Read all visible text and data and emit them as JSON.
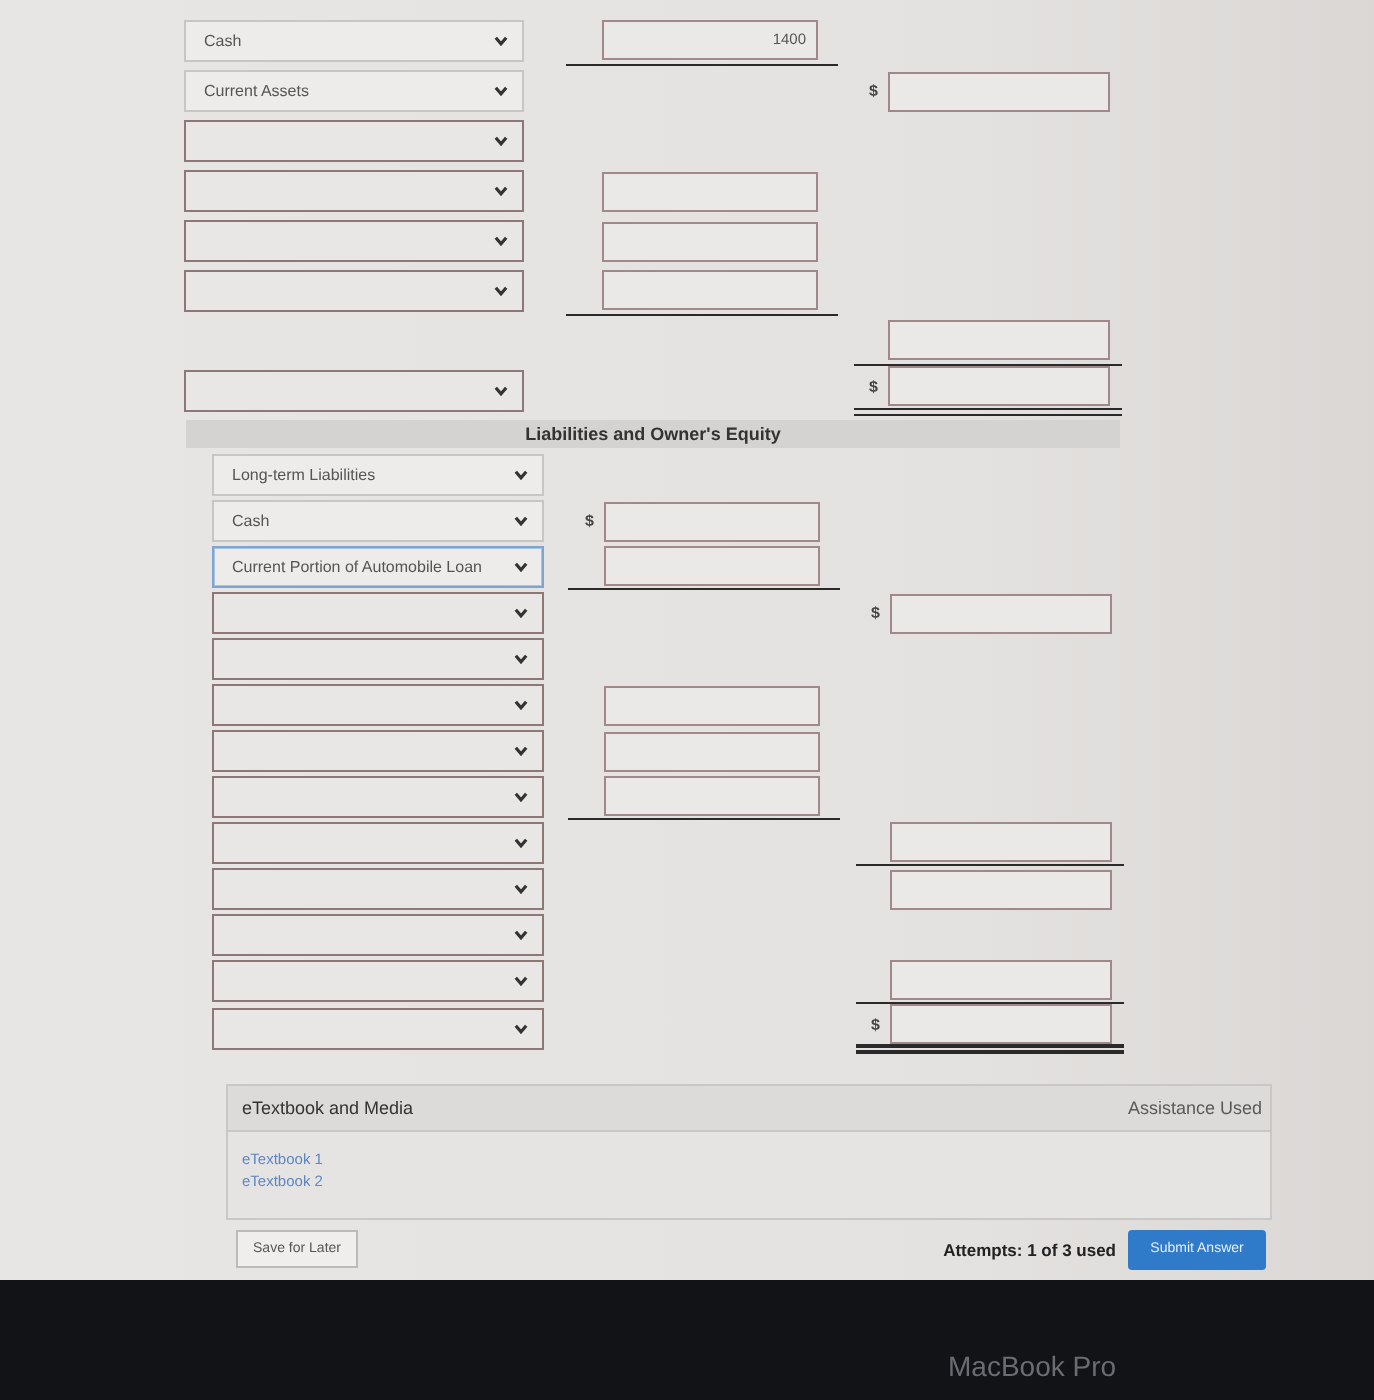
{
  "assets": {
    "rows": [
      {
        "account": {
          "value": "Cash",
          "focused": false
        },
        "amount": {
          "value": "1400",
          "underlined": true,
          "double_underlined": false
        }
      },
      {
        "account": {
          "value": "Current Assets",
          "focused": false
        },
        "total": {
          "currency": "$",
          "underlined": false,
          "double_underlined": false
        }
      },
      {
        "account": {
          "focused": false
        }
      },
      {
        "account": {
          "focused": false
        },
        "amount": {
          "underlined": false,
          "double_underlined": false
        }
      },
      {
        "account": {
          "focused": false
        },
        "amount": {
          "underlined": false,
          "double_underlined": false
        }
      },
      {
        "account": {
          "focused": false
        },
        "amount": {
          "underlined": true,
          "double_underlined": false
        }
      },
      {
        "total": {
          "underlined": true,
          "double_underlined": false
        }
      },
      {
        "account": {
          "focused": false
        },
        "total": {
          "currency": "$",
          "underlined": true,
          "double_underlined": true
        }
      }
    ]
  },
  "liabilities": {
    "header": "Liabilities and Owner's Equity",
    "rows": [
      {
        "account": {
          "value": "Long-term Liabilities",
          "focused": false
        }
      },
      {
        "account": {
          "value": "Cash",
          "focused": false
        },
        "amount": {
          "currency": "$",
          "underlined": false,
          "double_underlined": false
        }
      },
      {
        "account": {
          "value": "Current Portion of Automobile Loan",
          "focused": true
        },
        "amount": {
          "underlined": true,
          "double_underlined": false
        }
      },
      {
        "account": {
          "focused": false
        },
        "total": {
          "currency": "$",
          "underlined": false,
          "double_underlined": false
        }
      },
      {
        "account": {
          "focused": false
        }
      },
      {
        "account": {
          "focused": false
        },
        "amount": {
          "underlined": false,
          "double_underlined": false
        }
      },
      {
        "account": {
          "focused": false
        },
        "amount": {
          "underlined": false,
          "double_underlined": false
        }
      },
      {
        "account": {
          "focused": false
        },
        "amount": {
          "underlined": true,
          "double_underlined": false
        }
      },
      {
        "account": {
          "focused": false
        },
        "total": {
          "underlined": true,
          "double_underlined": false
        }
      },
      {
        "account": {
          "focused": false
        },
        "total": {
          "underlined": false,
          "double_underlined": false
        }
      },
      {
        "account": {
          "focused": false
        }
      },
      {
        "account": {
          "focused": false
        },
        "total": {
          "underlined": true,
          "double_underlined": false
        }
      },
      {
        "account": {
          "focused": false
        },
        "total": {
          "currency": "$",
          "underlined": true,
          "double_underlined": true
        }
      }
    ]
  },
  "media": {
    "title": "eTextbook and Media",
    "status": "Assistance Used",
    "links": [
      "eTextbook 1",
      "eTextbook 2"
    ]
  },
  "footer": {
    "save_button": "Save for Later",
    "attempts": "Attempts: 1 of 3 used",
    "submit_button": "Submit Answer"
  },
  "bezel": {
    "label": "MacBook Pro"
  }
}
